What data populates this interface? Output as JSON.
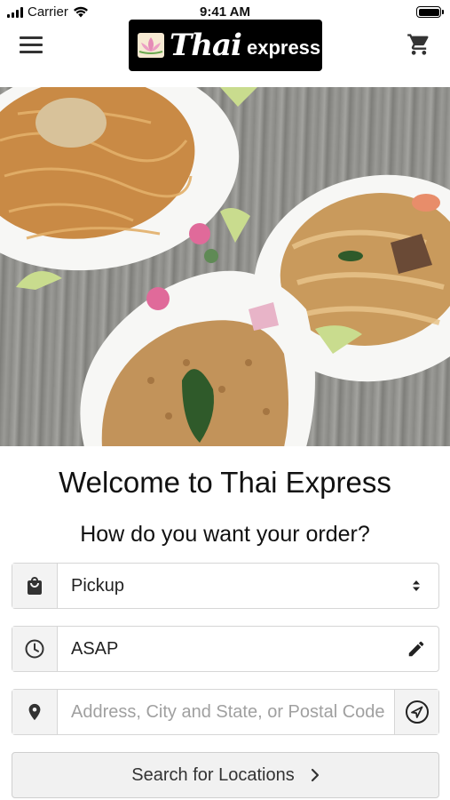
{
  "status_bar": {
    "carrier": "Carrier",
    "time": "9:41 AM"
  },
  "header": {
    "logo_word_thai": "Thai",
    "logo_word_express": "express",
    "menu_icon": "hamburger-menu-icon",
    "cart_icon": "shopping-cart-icon"
  },
  "main": {
    "welcome": "Welcome to Thai Express",
    "question": "How do you want your order?"
  },
  "form": {
    "order_type": {
      "icon": "shopping-bag-icon",
      "value": "Pickup",
      "options": [
        "Pickup"
      ]
    },
    "time": {
      "icon": "clock-icon",
      "value": "ASAP",
      "edit_icon": "pencil-icon"
    },
    "address": {
      "icon": "location-pin-icon",
      "placeholder": "Address, City and State, or Postal Code",
      "value": "",
      "locate_icon": "navigation-arrow-icon"
    },
    "search_button": {
      "label": "Search for Locations",
      "icon": "chevron-right-icon"
    }
  },
  "colors": {
    "logo_bg": "#000000",
    "field_border": "#d6d6d6",
    "field_icon_bg": "#f3f3f3",
    "button_bg": "#f1f1f1",
    "placeholder": "#a0a0a0"
  }
}
